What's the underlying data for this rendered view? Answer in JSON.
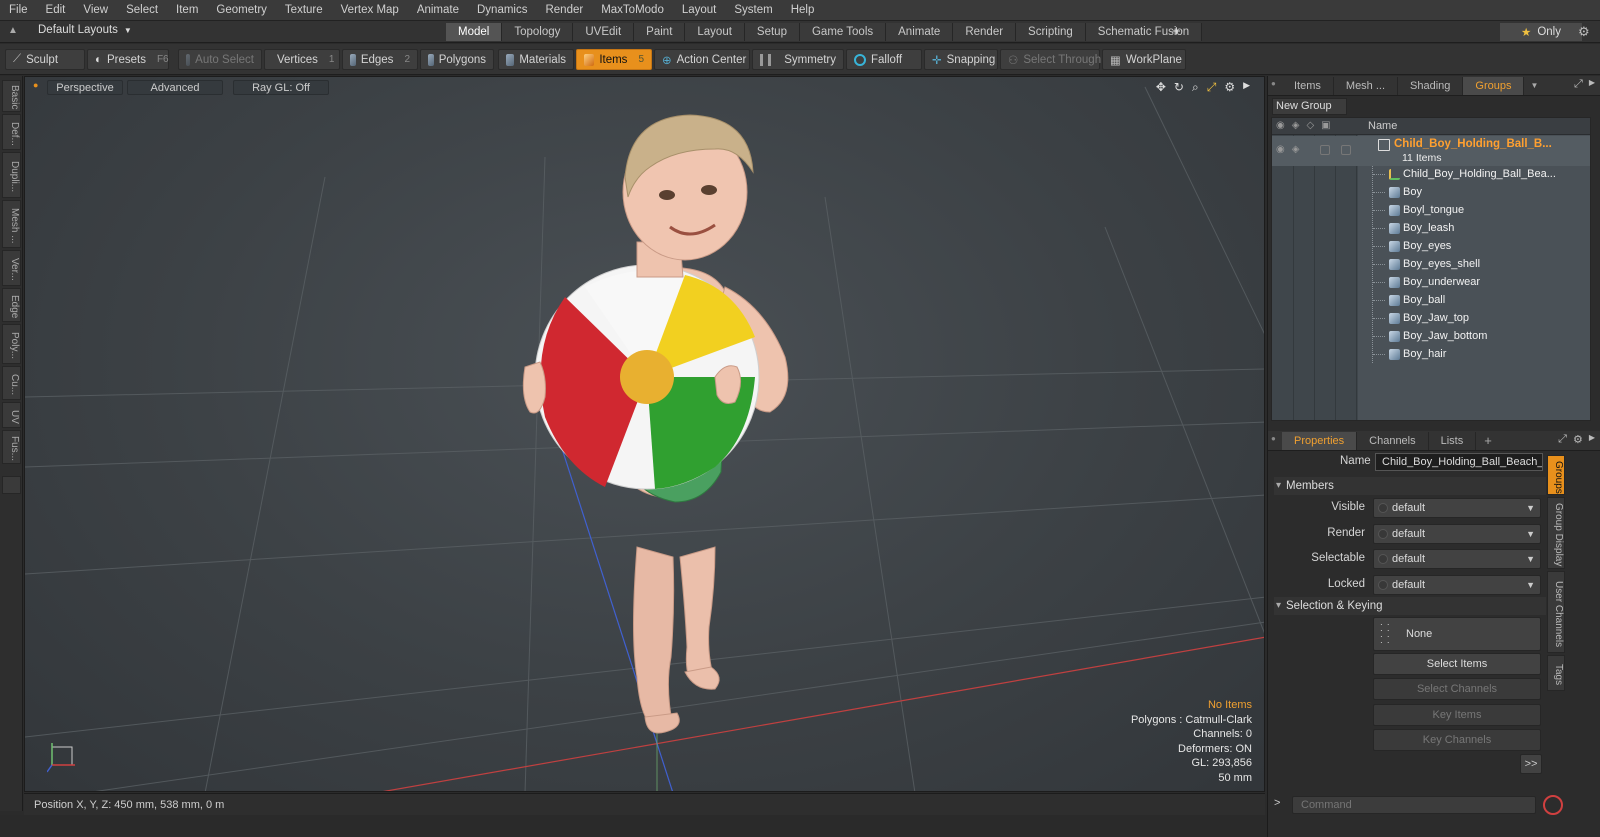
{
  "menu": [
    "File",
    "Edit",
    "View",
    "Select",
    "Item",
    "Geometry",
    "Texture",
    "Vertex Map",
    "Animate",
    "Dynamics",
    "Render",
    "MaxToModo",
    "Layout",
    "System",
    "Help"
  ],
  "layouts": {
    "label": "Default Layouts"
  },
  "mode_tabs": [
    "Model",
    "Topology",
    "UVEdit",
    "Paint",
    "Layout",
    "Setup",
    "Game Tools",
    "Animate",
    "Render",
    "Scripting",
    "Schematic Fusion"
  ],
  "active_mode": "Model",
  "only_label": "Only",
  "toolbar": {
    "sculpt": "Sculpt",
    "presets": "Presets",
    "presets_key": "F6",
    "auto_select": "Auto Select",
    "vertices": "Vertices",
    "vertices_key": "1",
    "edges": "Edges",
    "edges_key": "2",
    "polygons": "Polygons",
    "materials": "Materials",
    "items": "Items",
    "items_key": "5",
    "action_center": "Action Center",
    "symmetry": "Symmetry",
    "falloff": "Falloff",
    "snapping": "Snapping",
    "select_through": "Select Through",
    "workplane": "WorkPlane"
  },
  "left_tabs": [
    "Basic",
    "Def...",
    "Dupli...",
    "Mesh ...",
    "Ver...",
    "Edge",
    "Poly...",
    "Cu...",
    "UV",
    "Fus..."
  ],
  "viewport": {
    "perspective": "Perspective",
    "advanced": "Advanced",
    "raygl": "Ray GL: Off",
    "info": {
      "no_items": "No Items",
      "polygons": "Polygons : Catmull-Clark",
      "channels": "Channels: 0",
      "deformers": "Deformers: ON",
      "gl": "GL: 293,856",
      "focal": "50 mm"
    }
  },
  "status": {
    "position": "Position X, Y, Z:  450 mm, 538 mm, 0 m"
  },
  "right_panel": {
    "tabs": [
      "Items",
      "Mesh ...",
      "Shading",
      "Groups"
    ],
    "active_tab": "Groups",
    "new_group": "New Group",
    "list_header": "Name",
    "group_name": "Child_Boy_Holding_Ball_B...",
    "group_count": "11 Items",
    "items": [
      "Child_Boy_Holding_Ball_Bea...",
      "Boy",
      "Boyl_tongue",
      "Boy_leash",
      "Boy_eyes",
      "Boy_eyes_shell",
      "Boy_underwear",
      "Boy_ball",
      "Boy_Jaw_top",
      "Boy_Jaw_bottom",
      "Boy_hair"
    ]
  },
  "properties": {
    "tabs": [
      "Properties",
      "Channels",
      "Lists"
    ],
    "active_tab": "Properties",
    "name_label": "Name",
    "name_value": "Child_Boy_Holding_Ball_Beach_St",
    "members_section": "Members",
    "visible_label": "Visible",
    "visible_value": "default",
    "render_label": "Render",
    "render_value": "default",
    "selectable_label": "Selectable",
    "selectable_value": "default",
    "locked_label": "Locked",
    "locked_value": "default",
    "selection_section": "Selection & Keying",
    "none_label": "None",
    "select_items": "Select Items",
    "select_channels": "Select Channels",
    "key_items": "Key Items",
    "key_channels": "Key Channels",
    "expand": ">>",
    "side_tabs": [
      "Groups",
      "Group Display",
      "User Channels",
      "Tags"
    ]
  },
  "command": {
    "placeholder": "Command"
  }
}
